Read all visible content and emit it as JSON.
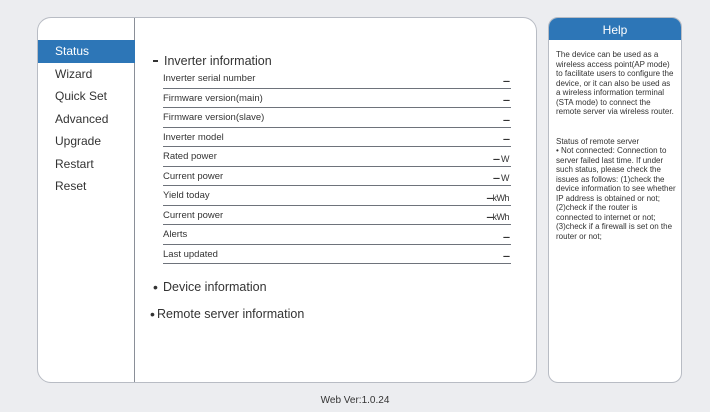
{
  "nav": {
    "items": [
      {
        "label": "Status",
        "active": true
      },
      {
        "label": "Wizard",
        "active": false
      },
      {
        "label": "Quick Set",
        "active": false
      },
      {
        "label": "Advanced",
        "active": false
      },
      {
        "label": "Upgrade",
        "active": false
      },
      {
        "label": "Restart",
        "active": false
      },
      {
        "label": "Reset",
        "active": false
      }
    ]
  },
  "inverter": {
    "title": "Inverter information",
    "rows": [
      {
        "label": "Inverter serial number",
        "value": "---",
        "unit": ""
      },
      {
        "label": "Firmware version(main)",
        "value": "---",
        "unit": ""
      },
      {
        "label": "Firmware version(slave)",
        "value": "---",
        "unit": ""
      },
      {
        "label": "Inverter model",
        "value": "---",
        "unit": ""
      },
      {
        "label": "Rated power",
        "value": "---",
        "unit": " W"
      },
      {
        "label": "Current power",
        "value": "---",
        "unit": " W"
      },
      {
        "label": "Yield today",
        "value": "---",
        "unit": "kWh"
      },
      {
        "label": "Current power",
        "value": "---",
        "unit": "kWh"
      },
      {
        "label": "Alerts",
        "value": "---",
        "unit": ""
      },
      {
        "label": "Last updated",
        "value": "---",
        "unit": ""
      }
    ]
  },
  "device_section": {
    "title": "Device information"
  },
  "remote_section": {
    "title": "Remote server information"
  },
  "help": {
    "title": "Help",
    "intro": "The device can be used as a wireless access point(AP mode) to facilitate users to configure the device, or it can also be used as a wireless information terminal (STA mode) to connect the remote server via wireless router.",
    "status_title": "Status of remote server",
    "status_body": "• Not connected: Connection to server failed last time. If under such status, please check the issues as follows: (1)check the device information to see whether IP address is obtained or not; (2)check if the router is connected to internet or not; (3)check if a firewall is set on the router or not;"
  },
  "footer": {
    "version": "Web Ver:1.0.24"
  },
  "colors": {
    "accent": "#2d76b7",
    "background": "#ecedf0"
  }
}
